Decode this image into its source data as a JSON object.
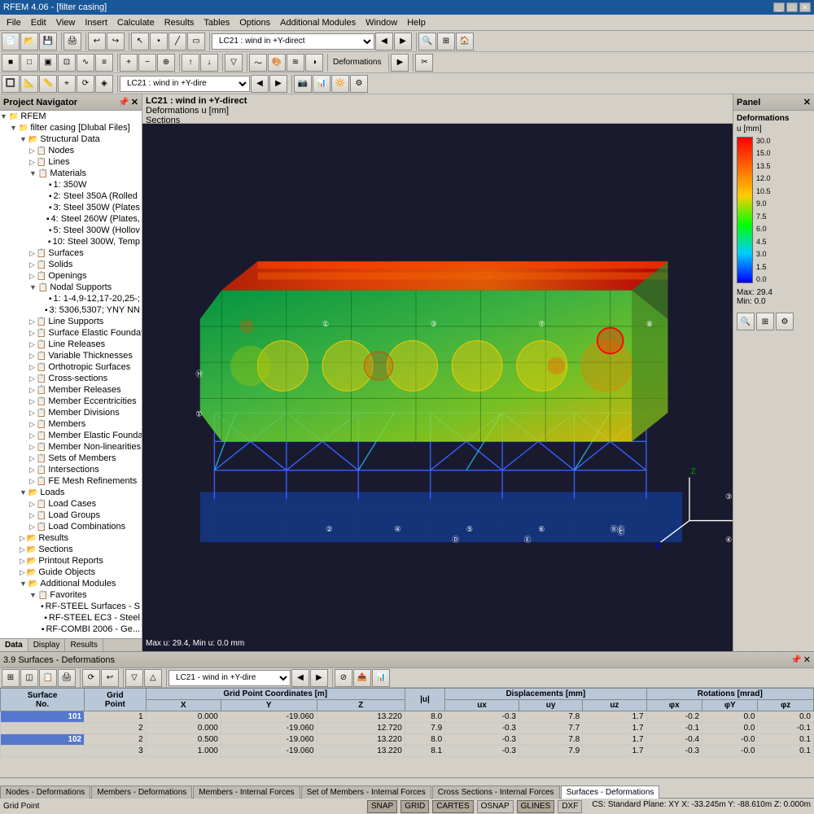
{
  "titleBar": {
    "title": "RFEM 4.06 - [filter casing]",
    "controls": [
      "_",
      "□",
      "✕"
    ]
  },
  "menuBar": {
    "items": [
      "File",
      "Edit",
      "View",
      "Insert",
      "Calculate",
      "Results",
      "Tables",
      "Options",
      "Additional Modules",
      "Window",
      "Help"
    ]
  },
  "toolbar": {
    "dropdown1": "LC21 : wind in +Y-direct",
    "dropdown2": "LC21 : wind in +Y-dire"
  },
  "viewHeader": {
    "line1": "LC21 : wind in +Y-direct",
    "line2": "Deformations u [mm]",
    "line3": "Sections"
  },
  "navigator": {
    "title": "Project Navigator",
    "tree": [
      {
        "level": 1,
        "label": "RFEM",
        "expand": "▼"
      },
      {
        "level": 2,
        "label": "filter casing [Dlubal Files]",
        "expand": "▼"
      },
      {
        "level": 3,
        "label": "Structural Data",
        "expand": "▼"
      },
      {
        "level": 4,
        "label": "Nodes",
        "expand": "▷"
      },
      {
        "level": 4,
        "label": "Lines",
        "expand": "▷"
      },
      {
        "level": 4,
        "label": "Materials",
        "expand": "▼"
      },
      {
        "level": 5,
        "label": "1: 350W"
      },
      {
        "level": 5,
        "label": "2: Steel 350A (Rolled"
      },
      {
        "level": 5,
        "label": "3: Steel 350W (Plates"
      },
      {
        "level": 5,
        "label": "4: Steel 260W (Plates,"
      },
      {
        "level": 5,
        "label": "5: Steel 300W (Hollov"
      },
      {
        "level": 5,
        "label": "10: Steel 300W, Temp"
      },
      {
        "level": 4,
        "label": "Surfaces",
        "expand": "▷"
      },
      {
        "level": 4,
        "label": "Solids",
        "expand": "▷"
      },
      {
        "level": 4,
        "label": "Openings",
        "expand": "▷"
      },
      {
        "level": 4,
        "label": "Nodal Supports",
        "expand": "▼"
      },
      {
        "level": 5,
        "label": "1: 1-4,9-12,17-20,25-;"
      },
      {
        "level": 5,
        "label": "3: 5306,5307; YNY NN"
      },
      {
        "level": 4,
        "label": "Line Supports",
        "expand": "▷"
      },
      {
        "level": 4,
        "label": "Surface Elastic Foundatio",
        "expand": "▷"
      },
      {
        "level": 4,
        "label": "Line Releases",
        "expand": "▷"
      },
      {
        "level": 4,
        "label": "Variable Thicknesses",
        "expand": "▷"
      },
      {
        "level": 4,
        "label": "Orthotropic Surfaces",
        "expand": "▷"
      },
      {
        "level": 4,
        "label": "Cross-sections",
        "expand": "▷"
      },
      {
        "level": 4,
        "label": "Member Releases",
        "expand": "▷"
      },
      {
        "level": 4,
        "label": "Member Eccentricities",
        "expand": "▷"
      },
      {
        "level": 4,
        "label": "Member Divisions",
        "expand": "▷"
      },
      {
        "level": 4,
        "label": "Members",
        "expand": "▷"
      },
      {
        "level": 4,
        "label": "Member Elastic Foundat",
        "expand": "▷"
      },
      {
        "level": 4,
        "label": "Member Non-linearities",
        "expand": "▷"
      },
      {
        "level": 4,
        "label": "Sets of Members",
        "expand": "▷"
      },
      {
        "level": 4,
        "label": "Intersections",
        "expand": "▷"
      },
      {
        "level": 4,
        "label": "FE Mesh Refinements",
        "expand": "▷"
      },
      {
        "level": 3,
        "label": "Loads",
        "expand": "▼"
      },
      {
        "level": 4,
        "label": "Load Cases",
        "expand": "▷"
      },
      {
        "level": 4,
        "label": "Load Groups",
        "expand": "▷"
      },
      {
        "level": 4,
        "label": "Load Combinations",
        "expand": "▷"
      },
      {
        "level": 3,
        "label": "Results",
        "expand": "▷"
      },
      {
        "level": 3,
        "label": "Sections",
        "expand": "▷"
      },
      {
        "level": 3,
        "label": "Printout Reports",
        "expand": "▷"
      },
      {
        "level": 3,
        "label": "Guide Objects",
        "expand": "▷"
      },
      {
        "level": 3,
        "label": "Additional Modules",
        "expand": "▼"
      },
      {
        "level": 4,
        "label": "Favorites",
        "expand": "▼"
      },
      {
        "level": 5,
        "label": "RF-STEEL Surfaces - S"
      },
      {
        "level": 5,
        "label": "RF-STEEL EC3 - Steel"
      },
      {
        "level": 5,
        "label": "RF-COMBI 2006 - Ge..."
      }
    ]
  },
  "navTabs": [
    "Data",
    "Display",
    "Results"
  ],
  "panel": {
    "title": "Panel",
    "deformTitle": "Deformations",
    "unit": "u [mm]",
    "legendValues": [
      "30.0",
      "15.0",
      "13.5",
      "12.0",
      "10.5",
      "9.0",
      "7.5",
      "6.0",
      "4.5",
      "3.0",
      "1.5",
      "0.0"
    ],
    "max": "Max: 29.4",
    "min": "Min: 0.0"
  },
  "resultsHeader": {
    "title": "3.9 Surfaces - Deformations",
    "docktitle": "3.9 Surfaces - Deformations"
  },
  "resultsDropdown": "LC21 - wind in +Y-dire",
  "tableColumns": {
    "surface": "Surface\nNo.",
    "grid": "Grid\nPoint",
    "gridPoint": "Grid Point",
    "coordsHeader": "Grid Point Coordinates [m]",
    "x": "X",
    "y": "Y",
    "z": "Z",
    "iul": "|u|",
    "displHeader": "Displacements [mm]",
    "ux": "ux",
    "uy": "uy",
    "uz": "uz",
    "rotHeader": "Rotations [mrad]",
    "ox": "φx",
    "oy": "φY",
    "oz": "φz"
  },
  "tableRows": [
    {
      "surface": "101",
      "grid": "1",
      "x": "0.000",
      "y": "-19.060",
      "z": "13.220",
      "iul": "8.0",
      "ux": "-0.3",
      "uy": "7.8",
      "uz": "1.7",
      "ox": "-0.2",
      "oy": "0.0",
      "oz": "0.0"
    },
    {
      "surface": "",
      "grid": "2",
      "x": "0.000",
      "y": "-19.060",
      "z": "12.720",
      "iul": "7.9",
      "ux": "-0.3",
      "uy": "7.7",
      "uz": "1.7",
      "ox": "-0.1",
      "oy": "0.0",
      "oz": "-0.1"
    },
    {
      "surface": "102",
      "grid": "2",
      "x": "0.500",
      "y": "-19.060",
      "z": "13.220",
      "iul": "8.0",
      "ux": "-0.3",
      "uy": "7.8",
      "uz": "1.7",
      "ox": "-0.4",
      "oy": "-0.0",
      "oz": "0.1"
    },
    {
      "surface": "",
      "grid": "3",
      "x": "1.000",
      "y": "-19.060",
      "z": "13.220",
      "iul": "8.1",
      "ux": "-0.3",
      "uy": "7.9",
      "uz": "1.7",
      "ox": "-0.3",
      "oy": "-0.0",
      "oz": "0.1"
    }
  ],
  "bottomTabs": [
    "Nodes - Deformations",
    "Members - Deformations",
    "Members - Internal Forces",
    "Set of Members - Internal Forces",
    "Cross Sections - Internal Forces",
    "Surfaces - Deformations"
  ],
  "statusLeft": {
    "point": "Grid Point"
  },
  "statusRight": {
    "snap": "SNAP",
    "grid": "GRID",
    "cartes": "CARTES",
    "osnap": "OSNAP",
    "glines": "GLINES",
    "dxf": "DXF",
    "coords": "CS: Standard  Plane: XY  X: -33.245m  Y: -88.610m  Z: 0.000m"
  },
  "viewportLabel": "Max u: 29.4, Min u: 0.0 mm"
}
